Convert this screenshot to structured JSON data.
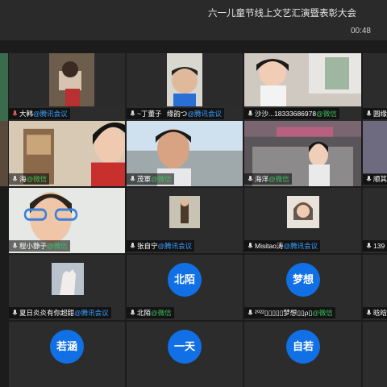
{
  "meeting": {
    "title": "六一儿童节线上文艺汇演暨表彰大会",
    "timer": "00:48"
  },
  "suffixes": {
    "tencent": "@腾讯会议",
    "wechat": "@微信"
  },
  "participants": [
    {
      "name": "大韩",
      "suffix": "@腾讯会议"
    },
    {
      "name": "~丁董子",
      "suffix": ""
    },
    {
      "name": "缘韵つ",
      "suffix": "@腾讯会议"
    },
    {
      "name": "沙沙...18333686978",
      "suffix": "@微信"
    },
    {
      "name": "圆缘",
      "suffix": ""
    },
    {
      "name": "海",
      "suffix": "@微信"
    },
    {
      "name": "茂軍",
      "suffix": "@微信"
    },
    {
      "name": "海洋",
      "suffix": "@微信"
    },
    {
      "name": "顺其",
      "suffix": ""
    },
    {
      "name": "程小静子",
      "suffix": "@微信"
    },
    {
      "name": "张自宁",
      "suffix": "@腾讯会议"
    },
    {
      "name": "Misitao涛",
      "suffix": "@腾讯会议"
    },
    {
      "name": "139",
      "suffix": ""
    },
    {
      "name": "夏日炎炎有你超甜",
      "suffix": "@腾讯会议"
    },
    {
      "name": "北陌",
      "suffix": "@微信"
    },
    {
      "name": "²⁰²²▯▯▯▯▯梦想▯▯ρ▯",
      "suffix": "@微信"
    },
    {
      "name": "晗晗",
      "suffix": ""
    },
    {
      "avatar": "北陌"
    },
    {
      "avatar": "梦想"
    },
    {
      "avatar": "若涵"
    },
    {
      "avatar": "一天"
    },
    {
      "avatar": "自若"
    }
  ]
}
